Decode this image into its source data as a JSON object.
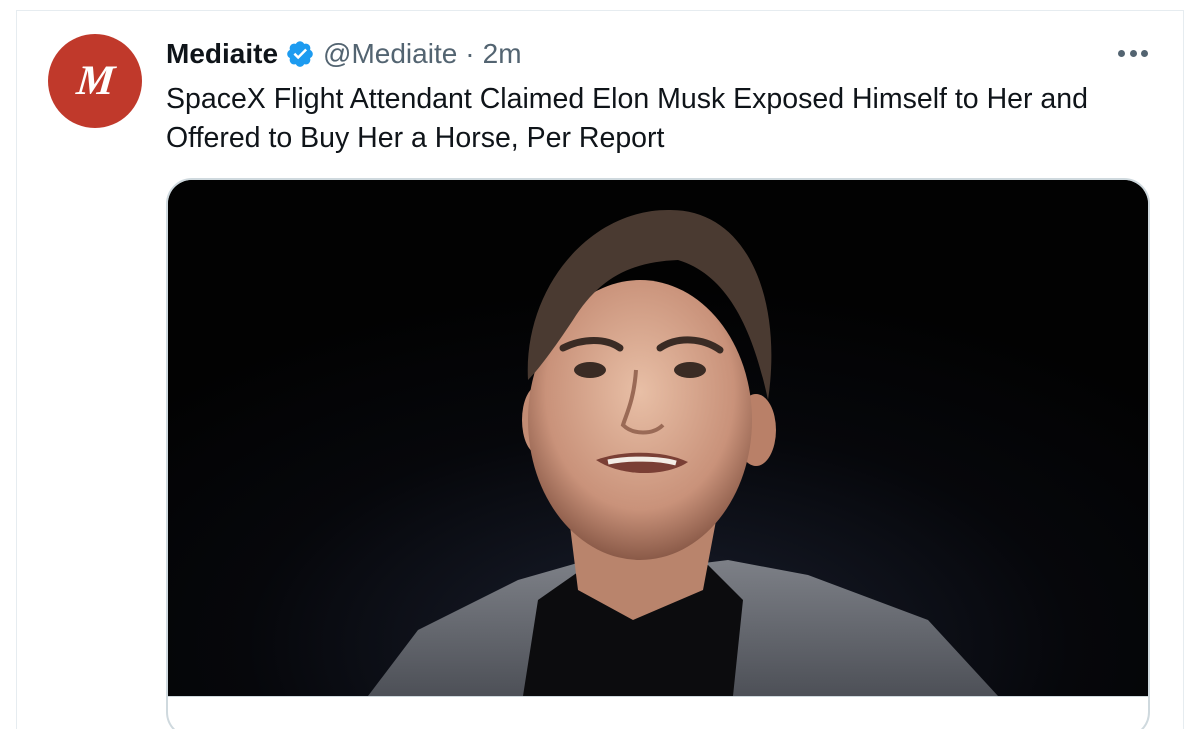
{
  "tweet": {
    "avatar_letter": "M",
    "display_name": "Mediaite",
    "verified_icon": "verified-badge-icon",
    "handle": "@Mediaite",
    "separator": "·",
    "timestamp": "2m",
    "more_icon": "more-horizontal-icon",
    "text_line1": "SpaceX Flight Attendant Claimed Elon Musk Exposed Himself to Her and",
    "text_line2": "Offered to Buy Her a Horse, Per Report"
  },
  "colors": {
    "avatar_bg": "#c0392b",
    "verified_blue": "#1d9bf0",
    "secondary_text": "#536471",
    "card_border": "#cfd9de"
  }
}
